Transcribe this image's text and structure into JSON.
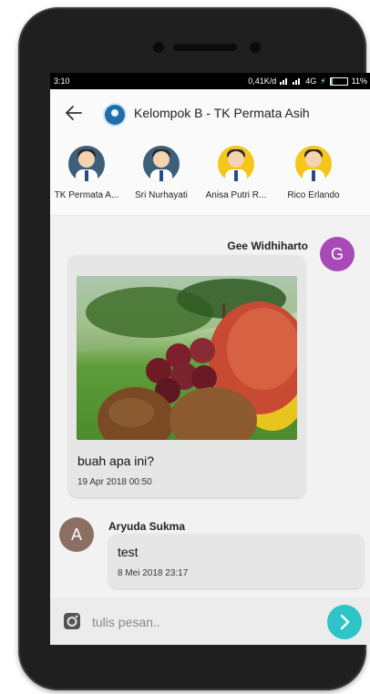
{
  "statusbar": {
    "time": "3:10",
    "indicators": "0,41K/d",
    "network": "4G",
    "battery": "11%",
    "battery_level": 0.11
  },
  "header": {
    "title": "Kelompok B - TK Permata Asih"
  },
  "members": [
    {
      "name": "TK Permata A...",
      "avatar_color": "#3e5f7a"
    },
    {
      "name": "Sri Nurhayati",
      "avatar_color": "#3e5f7a"
    },
    {
      "name": "Anisa Putri R...",
      "avatar_color": "#f5c518"
    },
    {
      "name": "Rico Erlando",
      "avatar_color": "#f5c518"
    }
  ],
  "messages": [
    {
      "sender": "Gee Widhiharto",
      "initial": "G",
      "avatar_color": "#a74ab8",
      "text": "buah apa ini?",
      "time": "19 Apr 2018 00:50"
    },
    {
      "sender": "Aryuda Sukma",
      "initial": "A",
      "avatar_color": "#8d6e63",
      "text": "test",
      "time": "8 Mei 2018 23:17"
    }
  ],
  "composer": {
    "placeholder": "tulis pesan.."
  },
  "colors": {
    "accent": "#2ec4c8"
  },
  "icons": {
    "back": "arrow-left-icon",
    "camera": "camera-icon",
    "send": "chevron-right-icon"
  }
}
